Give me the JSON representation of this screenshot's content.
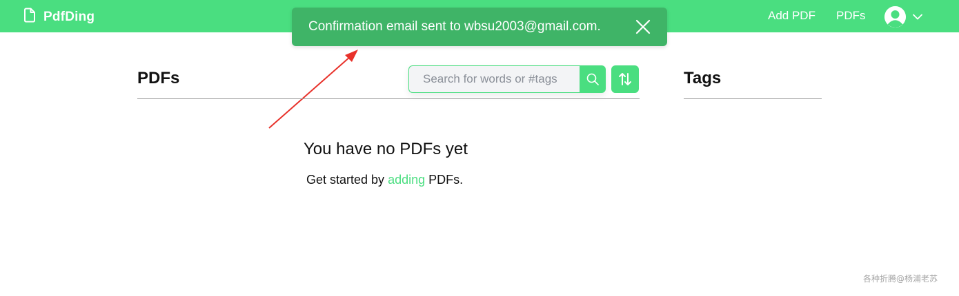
{
  "header": {
    "brand": "PdfDing",
    "nav": {
      "add_pdf": "Add PDF",
      "pdfs": "PDFs"
    },
    "user_icon": "user-avatar-icon",
    "menu_icon": "chevron-down-icon"
  },
  "toast": {
    "message": "Confirmation email sent to wbsu2003@gmail.com.",
    "close_icon": "close-icon"
  },
  "pdfs_panel": {
    "title": "PDFs",
    "search": {
      "placeholder": "Search for words or #tags",
      "value": ""
    },
    "search_icon": "search-icon",
    "sort_icon": "sort-icon"
  },
  "tags_panel": {
    "title": "Tags"
  },
  "empty_state": {
    "heading": "You have no PDFs yet",
    "text_before": "Get started by ",
    "link": "adding",
    "text_after": " PDFs."
  },
  "watermark": "各种折腾@杨浦老苏",
  "colors": {
    "brand_green": "#4ade80",
    "toast_green": "#3fb467",
    "annotation_red": "#e8312a"
  }
}
